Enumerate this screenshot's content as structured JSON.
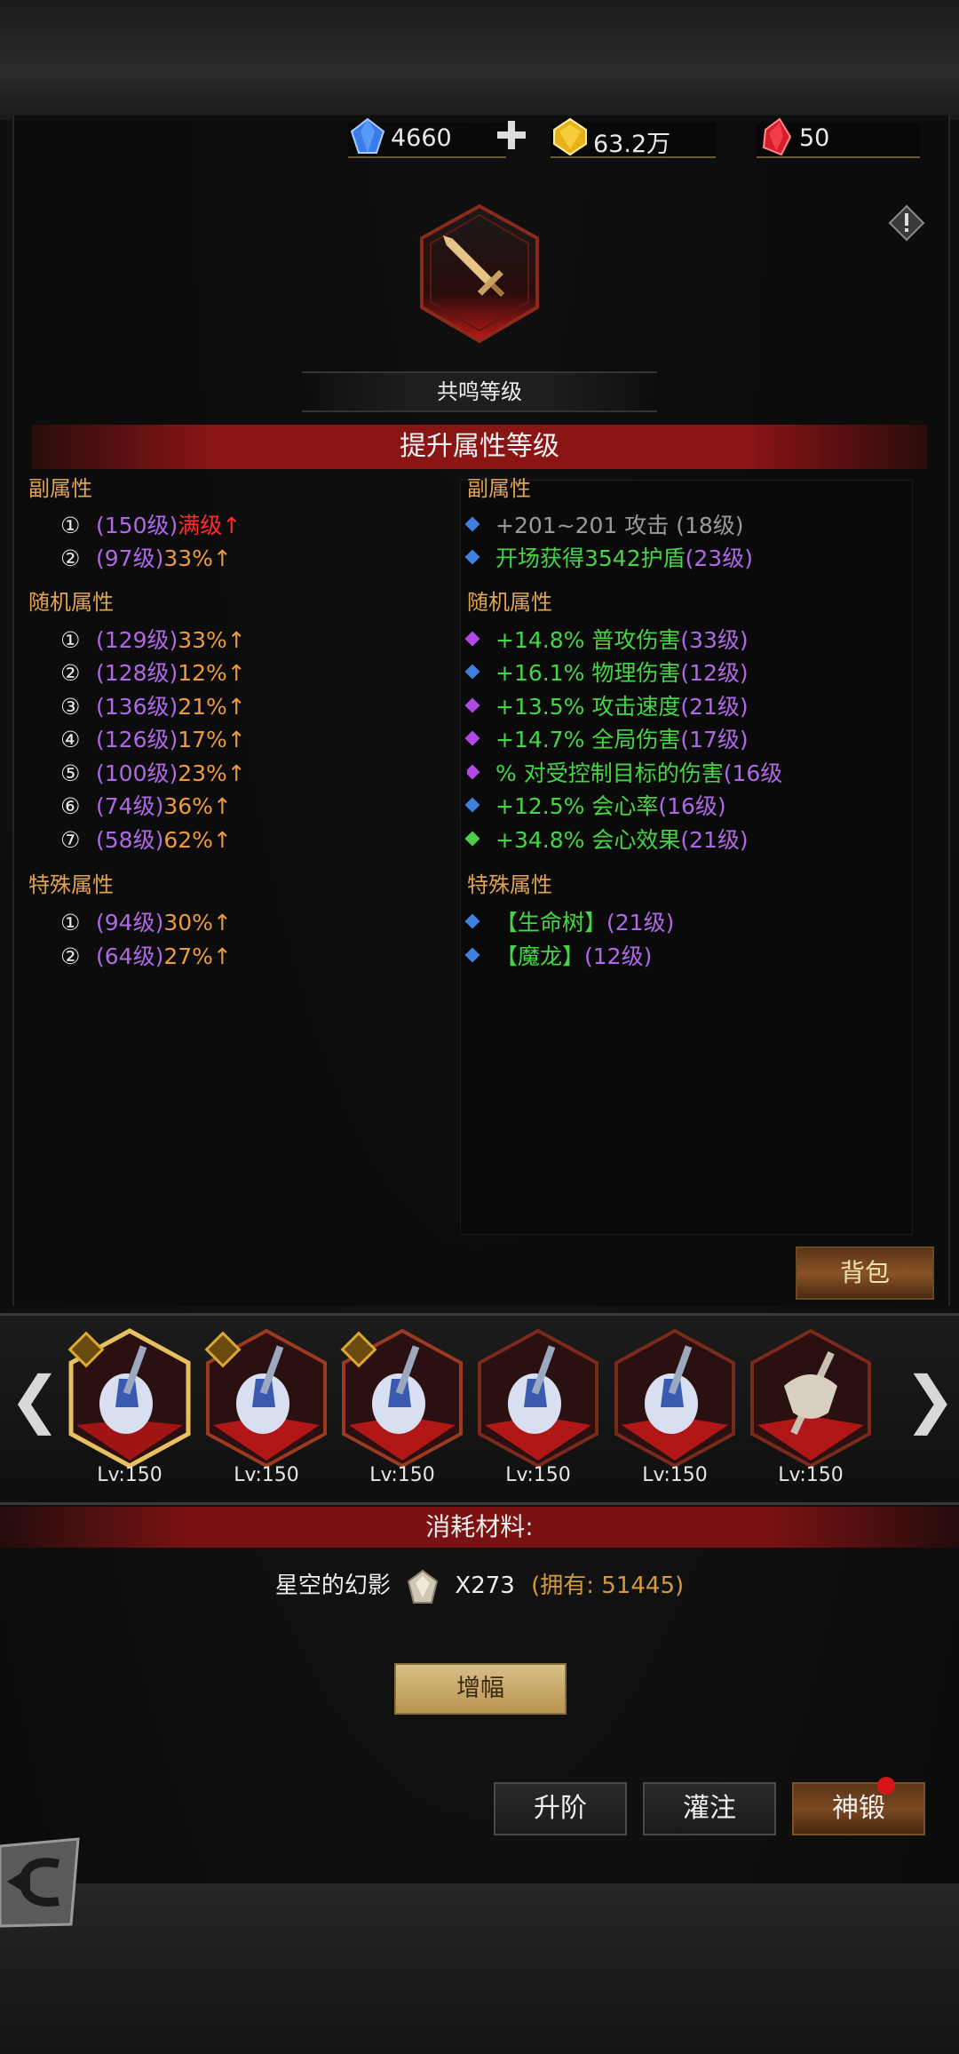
{
  "currencies": {
    "diamond": "4660",
    "gold": "63.2万",
    "ruby": "50"
  },
  "resonance_label": "共鸣等级",
  "banner_title": "提升属性等级",
  "left": {
    "secondary_title": "副属性",
    "secondary": [
      {
        "num": "①",
        "lv": "(150级)",
        "val": "满级↑",
        "max": true
      },
      {
        "num": "②",
        "lv": "(97级)",
        "val": "33%↑"
      }
    ],
    "random_title": "随机属性",
    "random": [
      {
        "num": "①",
        "lv": "(129级)",
        "val": "33%↑"
      },
      {
        "num": "②",
        "lv": "(128级)",
        "val": "12%↑"
      },
      {
        "num": "③",
        "lv": "(136级)",
        "val": "21%↑"
      },
      {
        "num": "④",
        "lv": "(126级)",
        "val": "17%↑"
      },
      {
        "num": "⑤",
        "lv": "(100级)",
        "val": "23%↑"
      },
      {
        "num": "⑥",
        "lv": "(74级)",
        "val": "36%↑"
      },
      {
        "num": "⑦",
        "lv": "(58级)",
        "val": "62%↑"
      }
    ],
    "special_title": "特殊属性",
    "special": [
      {
        "num": "①",
        "lv": "(94级)",
        "val": "30%↑"
      },
      {
        "num": "②",
        "lv": "(64级)",
        "val": "27%↑"
      }
    ]
  },
  "right": {
    "secondary_title": "副属性",
    "secondary": [
      {
        "bullet": "blue",
        "text": "+201~201 攻击",
        "lv": "(18级)",
        "color": "grey"
      },
      {
        "bullet": "blue",
        "text": "开场获得3542护盾",
        "lv": "(23级)",
        "color": "green"
      }
    ],
    "random_title": "随机属性",
    "random": [
      {
        "bullet": "purple",
        "text": "+14.8% 普攻伤害",
        "lv": "(33级)"
      },
      {
        "bullet": "blue",
        "text": "+16.1% 物理伤害",
        "lv": "(12级)"
      },
      {
        "bullet": "purple",
        "text": "+13.5% 攻击速度",
        "lv": "(21级)"
      },
      {
        "bullet": "purple",
        "text": "+14.7% 全局伤害",
        "lv": "(17级)"
      },
      {
        "bullet": "purple",
        "text": "% 对受控制目标的伤害",
        "lv": "(16级"
      },
      {
        "bullet": "blue",
        "text": "+12.5% 会心率",
        "lv": "(16级)"
      },
      {
        "bullet": "green",
        "text": "+34.8% 会心效果",
        "lv": "(21级)"
      }
    ],
    "special_title": "特殊属性",
    "special": [
      {
        "bullet": "blue",
        "text": "【生命树】",
        "lv": "(21级)"
      },
      {
        "bullet": "blue",
        "text": "【魔龙】",
        "lv": "(12级)"
      }
    ]
  },
  "bag_label": "背包",
  "carousel": {
    "items": [
      {
        "lv": "Lv:150"
      },
      {
        "lv": "Lv:150"
      },
      {
        "lv": "Lv:150"
      },
      {
        "lv": "Lv:150"
      },
      {
        "lv": "Lv:150"
      },
      {
        "lv": "Lv:150"
      }
    ]
  },
  "consume_title": "消耗材料:",
  "material": {
    "name": "星空的幻影",
    "qty": "X273",
    "owned": "(拥有: 51445)"
  },
  "amplify_label": "增幅",
  "actions": {
    "ascend": "升阶",
    "infuse": "灌注",
    "forge": "神锻"
  },
  "colors": {
    "accent_red": "#8a1515",
    "level_purple": "#b069e6",
    "percent_orange": "#ee9a3e",
    "attr_green": "#45d545"
  }
}
